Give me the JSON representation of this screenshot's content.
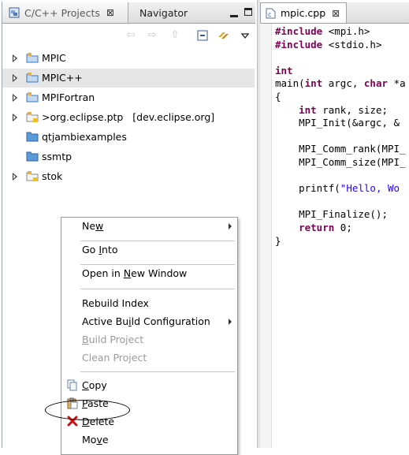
{
  "left_view": {
    "tabs": [
      {
        "label": "C/C++ Projects",
        "close": "⊠"
      },
      {
        "label": "Navigator"
      }
    ],
    "tree": [
      {
        "label": "MPIC",
        "expandable": true,
        "icon": "project-folder-icon"
      },
      {
        "label": "MPIC++",
        "expandable": true,
        "icon": "project-folder-icon",
        "selected": true
      },
      {
        "label": "MPIFortran",
        "expandable": true,
        "icon": "project-folder-icon"
      },
      {
        "label": ">org.eclipse.ptp   [dev.eclipse.org]",
        "expandable": true,
        "icon": "cvs-project-folder-icon"
      },
      {
        "label": "qtjambiexamples",
        "expandable": false,
        "icon": "closed-folder-icon"
      },
      {
        "label": "ssmtp",
        "expandable": false,
        "icon": "closed-folder-icon"
      },
      {
        "label": "stok",
        "expandable": true,
        "icon": "cvs-project-folder-icon"
      }
    ]
  },
  "editor": {
    "tab_label": "mpic.cpp",
    "tab_close": "⊠",
    "code_lines": [
      "#include <mpi.h>",
      "#include <stdio.h>",
      "",
      "int",
      "main(int argc, char *a",
      "{",
      "    int rank, size;",
      "    MPI_Init(&argc, &",
      "",
      "    MPI_Comm_rank(MPI_",
      "    MPI_Comm_size(MPI_",
      "",
      "    printf(\"Hello, Wo",
      "",
      "    MPI_Finalize();",
      "    return 0;",
      "}"
    ]
  },
  "context_menu": {
    "items": [
      {
        "pre": "Ne",
        "mn": "w",
        "post": "",
        "submenu": true
      },
      {
        "sep": true
      },
      {
        "pre": "Go ",
        "mn": "I",
        "post": "nto"
      },
      {
        "sep": true
      },
      {
        "pre": "Open in ",
        "mn": "N",
        "post": "ew Window"
      },
      {
        "sep": true
      },
      {
        "pre": "Rebuild Index",
        "mn": "",
        "post": ""
      },
      {
        "pre": "Active Bu",
        "mn": "i",
        "post": "ld Configuration",
        "submenu": true
      },
      {
        "pre": "",
        "mn": "B",
        "post": "uild Project",
        "disabled": true
      },
      {
        "pre": "Clean Project",
        "mn": "",
        "post": "",
        "disabled": true
      },
      {
        "sep": true
      },
      {
        "pre": "",
        "mn": "C",
        "post": "opy",
        "icon": "copy-icon"
      },
      {
        "pre": "",
        "mn": "P",
        "post": "aste",
        "icon": "paste-icon",
        "highlighted": true
      },
      {
        "pre": "",
        "mn": "D",
        "post": "elete",
        "icon": "delete-icon"
      },
      {
        "pre": "Mo",
        "mn": "v",
        "post": "e"
      }
    ]
  },
  "colors": {
    "keyword": "#7f0055",
    "string": "#2a00ff",
    "delete_icon": "#cc1010",
    "folder": "#3b78c4"
  }
}
